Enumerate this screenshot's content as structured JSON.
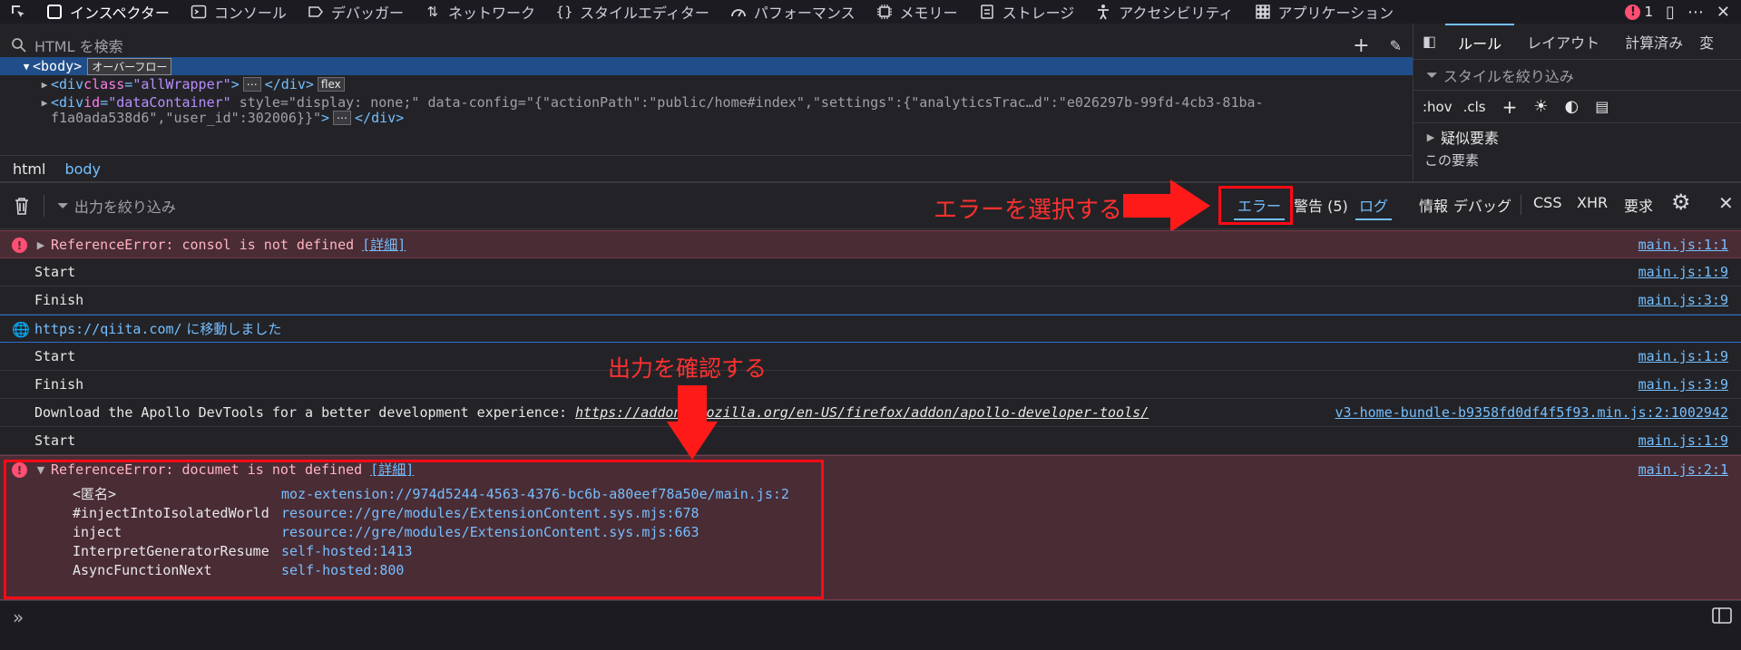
{
  "toolbar": {
    "tools": [
      {
        "label": "インスペクター",
        "icon": "inspector-icon",
        "active": true
      },
      {
        "label": "コンソール",
        "icon": "console-icon"
      },
      {
        "label": "デバッガー",
        "icon": "debugger-icon"
      },
      {
        "label": "ネットワーク",
        "icon": "network-icon"
      },
      {
        "label": "スタイルエディター",
        "icon": "style-editor-icon"
      },
      {
        "label": "パフォーマンス",
        "icon": "performance-icon"
      },
      {
        "label": "メモリー",
        "icon": "memory-icon"
      },
      {
        "label": "ストレージ",
        "icon": "storage-icon"
      },
      {
        "label": "アクセシビリティ",
        "icon": "accessibility-icon"
      },
      {
        "label": "アプリケーション",
        "icon": "application-icon"
      }
    ],
    "error_count": "1"
  },
  "inspector": {
    "search_placeholder": "HTML を検索",
    "body_tag": "<body>",
    "overflow_badge": "オーバーフロー",
    "line2": {
      "open": "<div ",
      "attr": "class",
      "eq": "=",
      "val": "\"allWrapper\"",
      "close": ">",
      "end": "</div>",
      "chip": "flex"
    },
    "line3": {
      "open": "<div ",
      "a1": "id",
      "v1": "\"dataContainer\"",
      "a2": "style",
      "v2": "\"display: none;\"",
      "a3": "data-config",
      "v3": "\"{\"actionPath\":\"public/home#index\",\"settings\":{\"analyticsTrac…d\":\"e026297b-99fd-4cb3-81ba-",
      "v3b": "f1a0ada538d6\",\"user_id\":302006}}\"",
      "close": ">",
      "end": "</div>"
    },
    "breadcrumbs": [
      "html",
      "body"
    ]
  },
  "rules_panel": {
    "tabs": [
      "ルール",
      "レイアウト",
      "計算済み",
      "変"
    ],
    "filter_placeholder": "スタイルを絞り込み",
    "hov": ":hov",
    "cls": ".cls",
    "pseudo_label": "疑似要素",
    "element_label": "この要素"
  },
  "console_bar": {
    "filter_placeholder": "出力を絞り込み",
    "levels": [
      {
        "label": "エラー",
        "active": true
      },
      {
        "label": "警告 (5)",
        "active": false
      },
      {
        "label": "ログ",
        "active": true
      },
      {
        "label": "情報",
        "active": false
      },
      {
        "label": "デバッグ",
        "active": false
      }
    ],
    "types": [
      "CSS",
      "XHR",
      "要求"
    ]
  },
  "annotations": {
    "select_error": "エラーを選択する",
    "check_output": "出力を確認する"
  },
  "console": {
    "messages": [
      {
        "kind": "error",
        "text": "ReferenceError: consol is not defined",
        "detail": "[詳細]",
        "loc": "main.js:1:1"
      },
      {
        "kind": "log",
        "text": "Start",
        "loc": "main.js:1:9"
      },
      {
        "kind": "log",
        "text": "Finish",
        "loc": "main.js:3:9"
      },
      {
        "kind": "nav",
        "url": "https://qiita.com/",
        "text": " に移動しました"
      },
      {
        "kind": "log",
        "text": "Start",
        "loc": "main.js:1:9"
      },
      {
        "kind": "log",
        "text": "Finish",
        "loc": "main.js:3:9"
      },
      {
        "kind": "log",
        "text": "Download the Apollo DevTools for a better development experience: ",
        "link": "https://addons.mozilla.org/en-US/firefox/addon/apollo-developer-tools/",
        "loc": "v3-home-bundle-b9358fd0df4f5f93.min.js:2:1002942"
      },
      {
        "kind": "log",
        "text": "Start",
        "loc": "main.js:1:9"
      },
      {
        "kind": "error",
        "text": "ReferenceError: documet is not defined",
        "detail": "[詳細]",
        "loc": "main.js:2:1"
      }
    ],
    "stack": [
      {
        "fn": "<匿名>",
        "src": "moz-extension://974d5244-4563-4376-bc6b-a80eef78a50e/main.js:2"
      },
      {
        "fn": "#injectIntoIsolatedWorld",
        "src": "resource://gre/modules/ExtensionContent.sys.mjs:678"
      },
      {
        "fn": "inject",
        "src": "resource://gre/modules/ExtensionContent.sys.mjs:663"
      },
      {
        "fn": "InterpretGeneratorResume",
        "src": "self-hosted:1413"
      },
      {
        "fn": "AsyncFunctionNext",
        "src": "self-hosted:800"
      }
    ]
  },
  "prompt": {
    "chevron": "»"
  }
}
